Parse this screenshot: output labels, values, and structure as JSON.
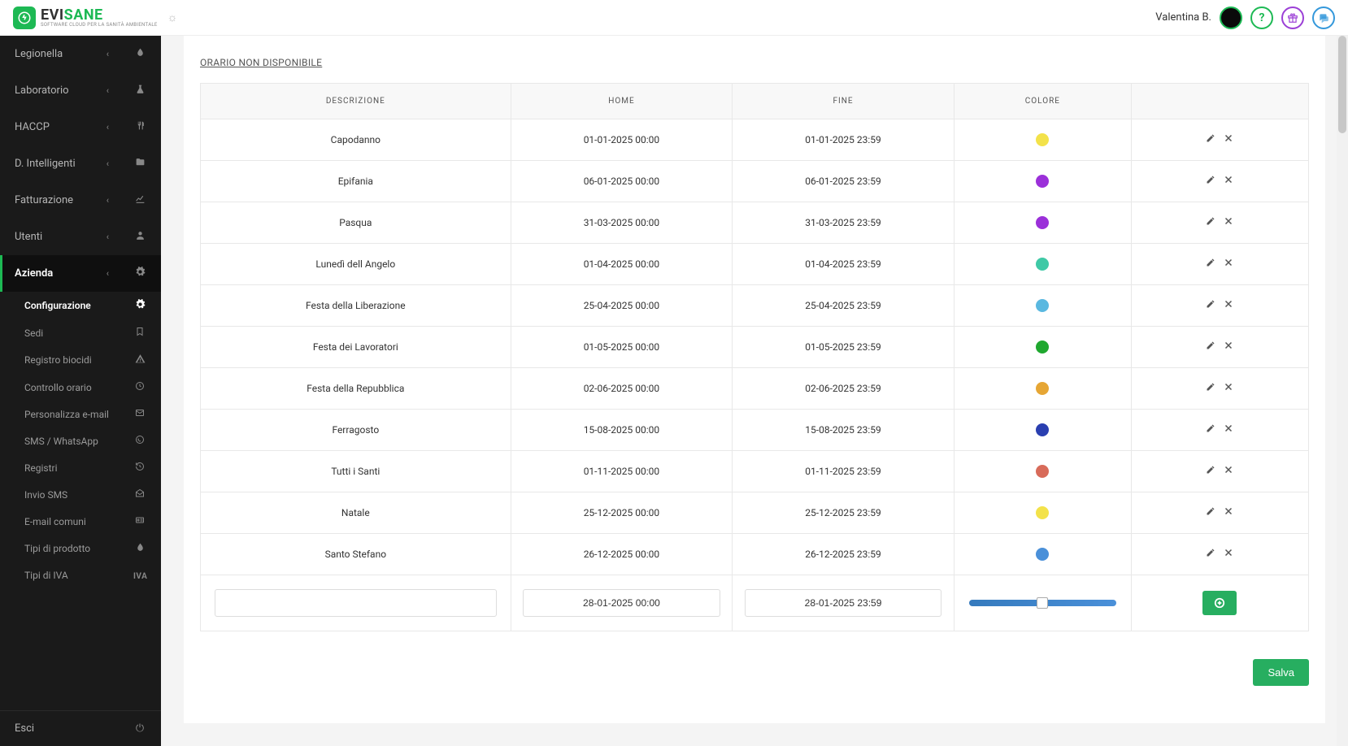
{
  "topbar": {
    "brand_plain": "EVI",
    "brand_accent": "SANE",
    "tagline": "SOFTWARE CLOUD PER LA SANITÀ AMBIENTALE",
    "username": "Valentina B."
  },
  "sidebar": {
    "items": [
      {
        "label": "Legionella",
        "icon": "drop"
      },
      {
        "label": "Laboratorio",
        "icon": "flask"
      },
      {
        "label": "HACCP",
        "icon": "utensils"
      },
      {
        "label": "D. Intelligenti",
        "icon": "folder"
      },
      {
        "label": "Fatturazione",
        "icon": "chart"
      },
      {
        "label": "Utenti",
        "icon": "user"
      },
      {
        "label": "Azienda",
        "icon": "gear",
        "active": true
      }
    ],
    "sub": [
      {
        "label": "Configurazione",
        "icon": "gear",
        "active": true
      },
      {
        "label": "Sedi",
        "icon": "bookmark"
      },
      {
        "label": "Registro biocidi",
        "icon": "warning"
      },
      {
        "label": "Controllo orario",
        "icon": "clock"
      },
      {
        "label": "Personalizza e-mail",
        "icon": "envelope"
      },
      {
        "label": "SMS / WhatsApp",
        "icon": "whatsapp"
      },
      {
        "label": "Registri",
        "icon": "history"
      },
      {
        "label": "Invio SMS",
        "icon": "envelope-open"
      },
      {
        "label": "E-mail comuni",
        "icon": "card"
      },
      {
        "label": "Tipi di prodotto",
        "icon": "drop"
      },
      {
        "label": "Tipi di IVA",
        "icon": "iva"
      }
    ],
    "exit": "Esci"
  },
  "section": {
    "title": "ORARIO NON DISPONIBILE",
    "headers": {
      "desc": "Descrizione",
      "start": "Home",
      "end": "Fine",
      "color": "Colore"
    },
    "rows": [
      {
        "desc": "Capodanno",
        "start": "01-01-2025 00:00",
        "end": "01-01-2025 23:59",
        "color": "#f3e24a"
      },
      {
        "desc": "Epifania",
        "start": "06-01-2025 00:00",
        "end": "06-01-2025 23:59",
        "color": "#9b30d9"
      },
      {
        "desc": "Pasqua",
        "start": "31-03-2025 00:00",
        "end": "31-03-2025 23:59",
        "color": "#9b30d9"
      },
      {
        "desc": "Lunedì dell Angelo",
        "start": "01-04-2025 00:00",
        "end": "01-04-2025 23:59",
        "color": "#3fc9a6"
      },
      {
        "desc": "Festa della Liberazione",
        "start": "25-04-2025 00:00",
        "end": "25-04-2025 23:59",
        "color": "#5ab8e0"
      },
      {
        "desc": "Festa dei Lavoratori",
        "start": "01-05-2025 00:00",
        "end": "01-05-2025 23:59",
        "color": "#1fa82f"
      },
      {
        "desc": "Festa della Repubblica",
        "start": "02-06-2025 00:00",
        "end": "02-06-2025 23:59",
        "color": "#e6a634"
      },
      {
        "desc": "Ferragosto",
        "start": "15-08-2025 00:00",
        "end": "15-08-2025 23:59",
        "color": "#2a3fb0"
      },
      {
        "desc": "Tutti i Santi",
        "start": "01-11-2025 00:00",
        "end": "01-11-2025 23:59",
        "color": "#d86b5a"
      },
      {
        "desc": "Natale",
        "start": "25-12-2025 00:00",
        "end": "25-12-2025 23:59",
        "color": "#f3e24a"
      },
      {
        "desc": "Santo Stefano",
        "start": "26-12-2025 00:00",
        "end": "26-12-2025 23:59",
        "color": "#4a90d9"
      }
    ],
    "new_row": {
      "desc": "",
      "start": "28-01-2025 00:00",
      "end": "28-01-2025 23:59"
    },
    "save_label": "Salva"
  },
  "icons": {
    "drop": "🔥",
    "flask": "⚗",
    "utensils": "🍴",
    "folder": "📁",
    "chart": "📈",
    "user": "👤",
    "gear": "⚙",
    "bookmark": "🔖",
    "warning": "⚠",
    "clock": "🕒",
    "envelope": "✉",
    "whatsapp": "✆",
    "history": "↺",
    "envelope-open": "📨",
    "card": "🪪",
    "power": "⏻"
  }
}
